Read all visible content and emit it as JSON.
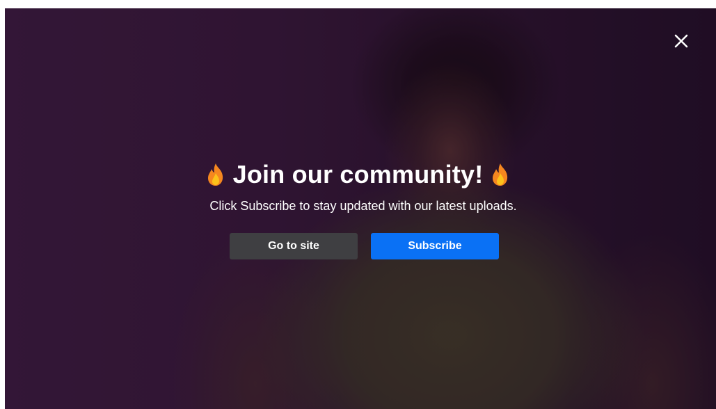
{
  "modal": {
    "title": "Join our community!",
    "subtitle": "Click Subscribe to stay updated with our latest uploads.",
    "title_icon": "flame-icon",
    "close_icon": "close-icon"
  },
  "buttons": {
    "go_to_site_label": "Go to site",
    "subscribe_label": "Subscribe"
  },
  "colors": {
    "subscribe_button": "#0a71f5",
    "go_to_site_button": "#3f3f42",
    "background": "#3a1a3e",
    "text": "#ffffff"
  }
}
